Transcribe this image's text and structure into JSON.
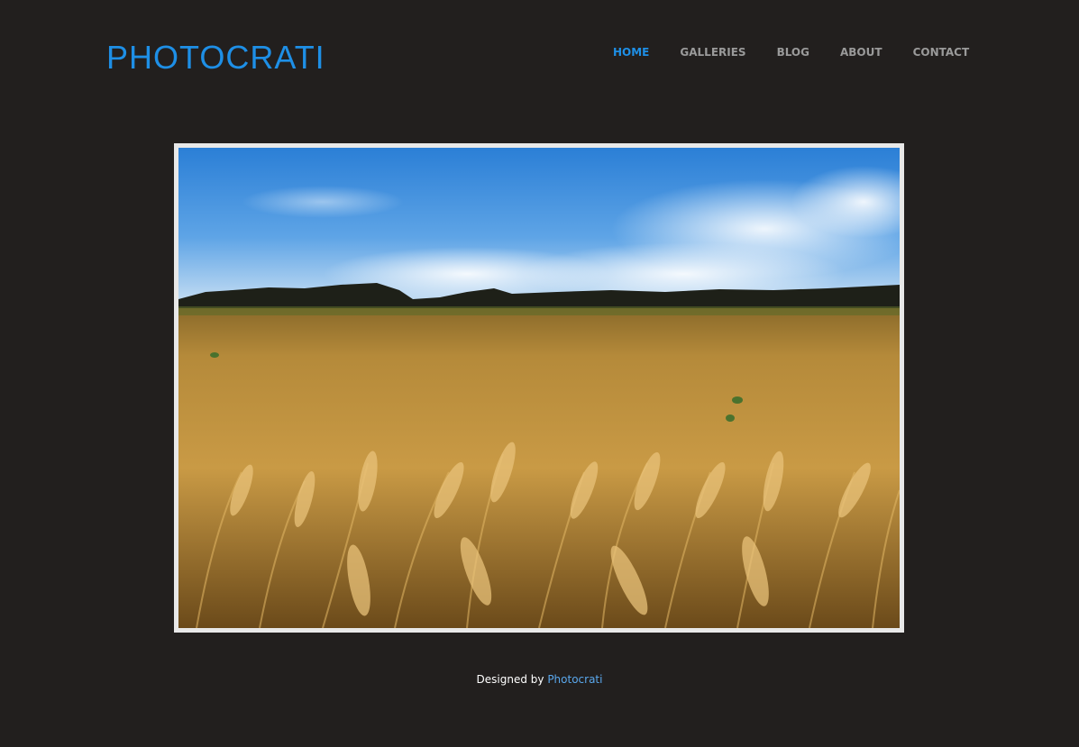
{
  "header": {
    "logo_text": "PHOTOCRATI"
  },
  "nav": {
    "items": [
      {
        "label": "HOME",
        "active": true
      },
      {
        "label": "GALLERIES",
        "active": false
      },
      {
        "label": "BLOG",
        "active": false
      },
      {
        "label": "ABOUT",
        "active": false
      },
      {
        "label": "CONTACT",
        "active": false
      }
    ]
  },
  "footer": {
    "prefix": "Designed by",
    "link_label": "Photocrati"
  },
  "colors": {
    "background": "#221f1e",
    "accent": "#1e8fe6",
    "nav_inactive": "#9a9a9a",
    "frame": "#e8e8e8"
  }
}
